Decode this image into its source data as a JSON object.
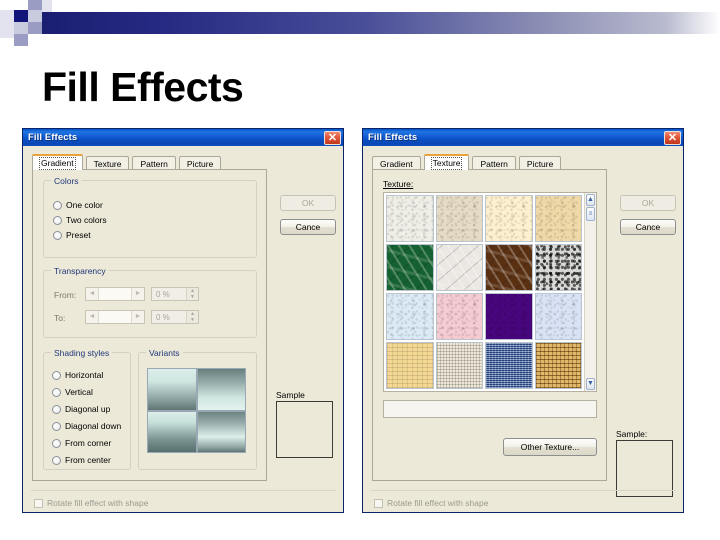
{
  "slide": {
    "title": "Fill Effects"
  },
  "header": {
    "accent_dark": "#13157a",
    "accent_mid": "#9a9cc4",
    "accent_light": "#c9cbdf",
    "accent_pale": "#e2e3ee",
    "bar_gradient_from": "#1b1f72",
    "bar_gradient_to": "#ffffff"
  },
  "dialog_gradient": {
    "title": "Fill Effects",
    "close_glyph": "✕",
    "tabs": [
      {
        "label": "Gradient",
        "active": true
      },
      {
        "label": "Texture",
        "active": false
      },
      {
        "label": "Pattern",
        "active": false
      },
      {
        "label": "Picture",
        "active": false
      }
    ],
    "colors_group": {
      "title": "Colors",
      "options": [
        {
          "label": "One color",
          "selected": false
        },
        {
          "label": "Two colors",
          "selected": false
        },
        {
          "label": "Preset",
          "selected": false
        }
      ]
    },
    "transparency_group": {
      "title": "Transparency",
      "from_label": "From:",
      "to_label": "To:",
      "from_value": "0 %",
      "to_value": "0 %",
      "left_arrow": "◄",
      "right_arrow": "►",
      "spin_up": "▲",
      "spin_down": "▼"
    },
    "shading_group": {
      "title": "Shading styles",
      "options": [
        {
          "label": "Horizontal",
          "selected": false
        },
        {
          "label": "Vertical",
          "selected": false
        },
        {
          "label": "Diagonal up",
          "selected": false
        },
        {
          "label": "Diagonal down",
          "selected": false
        },
        {
          "label": "From corner",
          "selected": false
        },
        {
          "label": "From center",
          "selected": false
        }
      ]
    },
    "variants_group": {
      "title": "Variants",
      "cells": [
        {
          "name": "variant-top-left",
          "gradient": "linear-gradient(to bottom, #dceee9 0%, #cfe6e1 30%, #8fa5a4 72%, #5f7675 100%)"
        },
        {
          "name": "variant-top-right",
          "gradient": "linear-gradient(to bottom, #67807e 0%, #8ea5a3 28%, #cfe6e1 70%, #e3f2ee 100%)"
        },
        {
          "name": "variant-bottom-left",
          "gradient": "linear-gradient(to bottom, #dcEEE9 0%, #c7e0db 26%, #79918f 70%, #56706e 100%)"
        },
        {
          "name": "variant-bottom-right",
          "gradient": "linear-gradient(to bottom, #6c8482 0%, #9db2b0 30%, #dcEEE9 62%, #8fa5a4 88%, #5f7675 100%)"
        }
      ]
    },
    "sample_label": "Sample",
    "buttons": {
      "ok": "OK",
      "ok_disabled": true,
      "cancel": "Cance"
    },
    "rotate_checkbox": {
      "label": "Rotate fill effect with shape",
      "checked": false,
      "disabled": true
    }
  },
  "dialog_texture": {
    "title": "Fill Effects",
    "close_glyph": "✕",
    "tabs": [
      {
        "label": "Gradient",
        "active": false
      },
      {
        "label": "Texture",
        "active": true
      },
      {
        "label": "Pattern",
        "active": false
      },
      {
        "label": "Picture",
        "active": false
      }
    ],
    "texture_label": "Texture:",
    "textures": [
      {
        "name": "newsprint",
        "base": "#efefe7",
        "style": "tex-noise"
      },
      {
        "name": "recycled-paper",
        "base": "#e6dcc6",
        "style": "tex-noise"
      },
      {
        "name": "parchment",
        "base": "#fdf0cf",
        "style": "tex-noise"
      },
      {
        "name": "sand",
        "base": "#efd9a8",
        "style": "tex-noise"
      },
      {
        "name": "green-marble",
        "base": "#156131",
        "style": "tex-marble"
      },
      {
        "name": "white-marble",
        "base": "#ebe7e2",
        "style": "tex-marble"
      },
      {
        "name": "brown-marble",
        "base": "#5a3012",
        "style": "tex-marble"
      },
      {
        "name": "granite",
        "base": "#d8d8d4",
        "style": "tex-speckle"
      },
      {
        "name": "blue-tissue",
        "base": "#dceaf6",
        "style": "tex-noise"
      },
      {
        "name": "pink-tissue",
        "base": "#f4ccd2",
        "style": "tex-noise"
      },
      {
        "name": "purple-mesh",
        "base": "#48067e",
        "style": "tex-noise"
      },
      {
        "name": "bouquet",
        "base": "#d9e3f5",
        "style": "tex-noise"
      },
      {
        "name": "papyrus",
        "base": "#f3d893",
        "style": "tex-paper"
      },
      {
        "name": "canvas",
        "base": "#e7e0cc",
        "style": "tex-weave"
      },
      {
        "name": "denim",
        "base": "#3c5f9e",
        "style": "tex-denim"
      },
      {
        "name": "woven-mat",
        "base": "#d2a24d",
        "style": "tex-basket"
      }
    ],
    "scrollbar": {
      "up_glyph": "▲",
      "down_glyph": "▼",
      "thumb_glyph": "≡"
    },
    "texture_name_value": "",
    "other_texture_button": "Other Texture...",
    "sample_label": "Sample:",
    "buttons": {
      "ok": "OK",
      "ok_disabled": true,
      "cancel": "Cance"
    },
    "rotate_checkbox": {
      "label": "Rotate fill effect with shape",
      "checked": false,
      "disabled": true
    }
  }
}
